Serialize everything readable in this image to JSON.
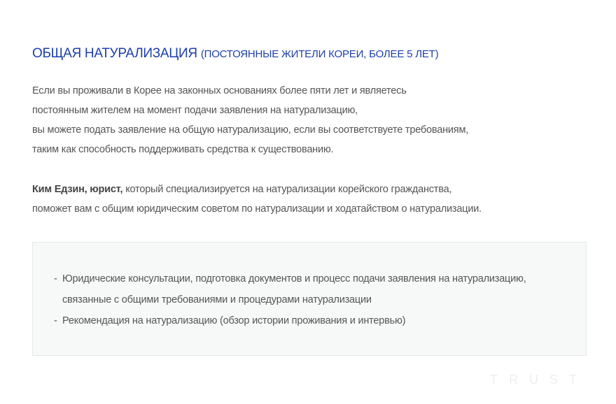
{
  "title": {
    "main": "ОБЩАЯ НАТУРАЛИЗАЦИЯ",
    "sub": "(ПОСТОЯННЫЕ ЖИТЕЛИ КОРЕИ, БОЛЕЕ 5 ЛЕТ)"
  },
  "intro": {
    "lines": [
      "Если вы проживали в Корее на законных основаниях более пяти лет и являетесь",
      "постоянным жителем на момент подачи заявления на натурализацию,",
      "вы можете подать заявление на общую натурализацию, если вы соответствуете требованиям,",
      "таким как способность поддерживать средства к существованию."
    ]
  },
  "lawyer": {
    "name": "Ким Едзин, юрист,",
    "line1_rest": " который специализируется на натурализации корейского гражданства,",
    "line2": "поможет вам с общим юридическим советом по натурализации и ходатайством о натурализации."
  },
  "services": {
    "dash": "-",
    "items": [
      {
        "line1": "Юридические консультации, подготовка документов и процесс подачи заявления на натурализацию,",
        "line2": "связанные с общими требованиями и процедурами натурализации"
      },
      {
        "line1": "Рекомендация на натурализацию (обзор истории проживания и интервью)"
      }
    ]
  },
  "watermark": "TRUST",
  "colors": {
    "title": "#1b3fae",
    "text": "#555555",
    "box_bg": "#f7f8f8",
    "box_border": "#e6e8e8",
    "watermark": "#eeeeee"
  }
}
